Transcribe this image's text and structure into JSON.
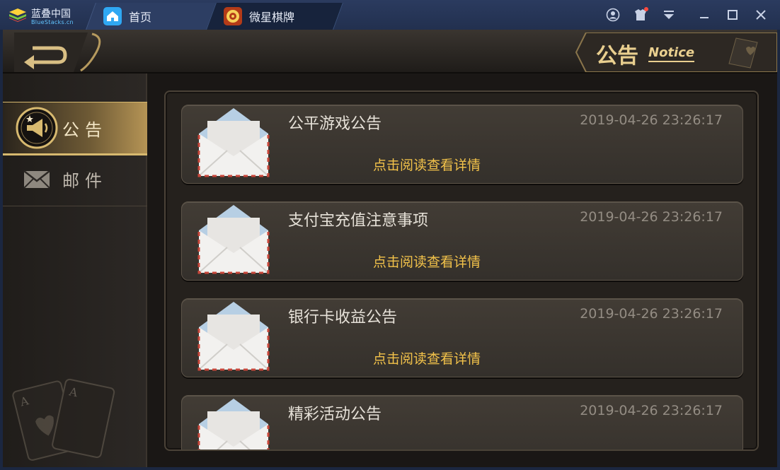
{
  "titlebar": {
    "brand_cn": "蓝叠中国",
    "brand_en": "BlueStacks.cn",
    "tabs": [
      {
        "label": "首页",
        "icon": "home-icon"
      },
      {
        "label": "微星棋牌",
        "icon": "game-app-icon"
      }
    ],
    "controls": [
      "account-icon",
      "gift-icon",
      "menu-dropdown-icon",
      "minimize-icon",
      "maximize-icon",
      "close-icon"
    ],
    "colors": {
      "bar": "#24324f",
      "notification_dot": "#ff4a3d"
    }
  },
  "header": {
    "title": "公告",
    "title_en": "Notice",
    "back_icon": "back-arrow-icon"
  },
  "sidebar": {
    "items": [
      {
        "label": "公告",
        "icon": "megaphone-icon",
        "active": true
      },
      {
        "label": "邮件",
        "icon": "mail-icon",
        "active": false
      }
    ]
  },
  "notices": [
    {
      "title": "公平游戏公告",
      "time": "2019-04-26 23:26:17",
      "link": "点击阅读查看详情"
    },
    {
      "title": "支付宝充值注意事项",
      "time": "2019-04-26 23:26:17",
      "link": "点击阅读查看详情"
    },
    {
      "title": "银行卡收益公告",
      "time": "2019-04-26 23:26:17",
      "link": "点击阅读查看详情"
    },
    {
      "title": "精彩活动公告",
      "time": "2019-04-26 23:26:17",
      "link": ""
    }
  ],
  "colors": {
    "gold": "#e9cf8f",
    "link": "#f2c24a",
    "panel": "#25211d"
  }
}
